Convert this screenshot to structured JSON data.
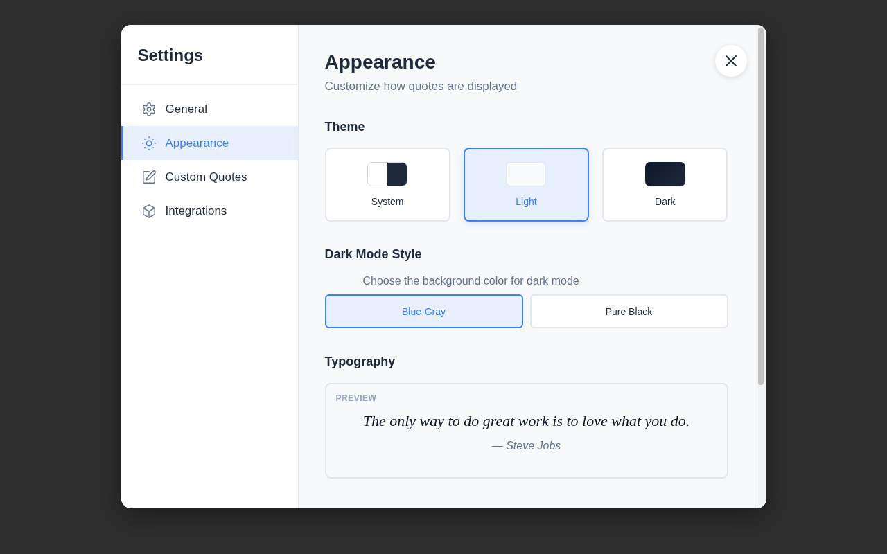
{
  "sidebar": {
    "title": "Settings",
    "items": [
      {
        "label": "General",
        "selected": false
      },
      {
        "label": "Appearance",
        "selected": true
      },
      {
        "label": "Custom Quotes",
        "selected": false
      },
      {
        "label": "Integrations",
        "selected": false
      }
    ]
  },
  "content": {
    "title": "Appearance",
    "subtitle": "Customize how quotes are displayed",
    "theme": {
      "heading": "Theme",
      "options": [
        {
          "label": "System",
          "kind": "split",
          "selected": false
        },
        {
          "label": "Light",
          "kind": "light",
          "selected": true
        },
        {
          "label": "Dark",
          "kind": "dark",
          "selected": false
        }
      ]
    },
    "dark_mode_style": {
      "heading": "Dark Mode Style",
      "description": "Choose the background color for dark mode",
      "options": [
        {
          "label": "Blue-Gray",
          "selected": true
        },
        {
          "label": "Pure Black",
          "selected": false
        }
      ]
    },
    "typography": {
      "heading": "Typography",
      "preview_label": "PREVIEW",
      "quote": "The only way to do great work is to love what you do.",
      "author": "— Steve Jobs"
    }
  }
}
